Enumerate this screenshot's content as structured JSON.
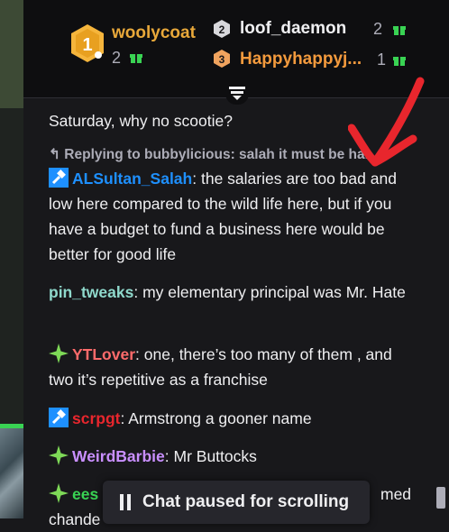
{
  "leaderboard": {
    "first": {
      "rank": "1",
      "name": "woolycoat",
      "count": "2"
    },
    "second": {
      "rank": "2",
      "name": "loof_daemon",
      "count": "2"
    },
    "third": {
      "rank": "3",
      "name": "Happyhappyj...",
      "count": "1"
    }
  },
  "messages": [
    {
      "text": "Saturday, why no scootie?"
    },
    {
      "reply": "Replying to bubbylicious: salah it must be ha..."
    },
    {
      "user": "ALSultan_Salah",
      "text": " the salaries are too bad and low here compared to the wild life here, but if you have a budget to fund a business here would be better for good life",
      "color": "#1e90ff"
    },
    {
      "user": "pin_tweaks",
      "text": " my elementary principal was Mr. Hate",
      "color": "#8fd9cc"
    },
    {
      "user": "YTLover",
      "text": " one, there’s too many of them , and two it’s repetitive as a franchise",
      "color": "#ff6b6b"
    },
    {
      "user": "scrpgt",
      "text": " Armstrong a gooner name",
      "color": "#e8262d"
    },
    {
      "user": "WeirdBarbie",
      "text": " Mr Buttocks",
      "color": "#c98fff"
    },
    {
      "user": "ees",
      "tail": "med",
      "tail2": "chande"
    }
  ],
  "paused_label": "Chat paused for scrolling",
  "colors": {
    "gold": "#e8a83a",
    "orange": "#f39a3d",
    "green": "#39d353",
    "bg": "#18181b"
  }
}
